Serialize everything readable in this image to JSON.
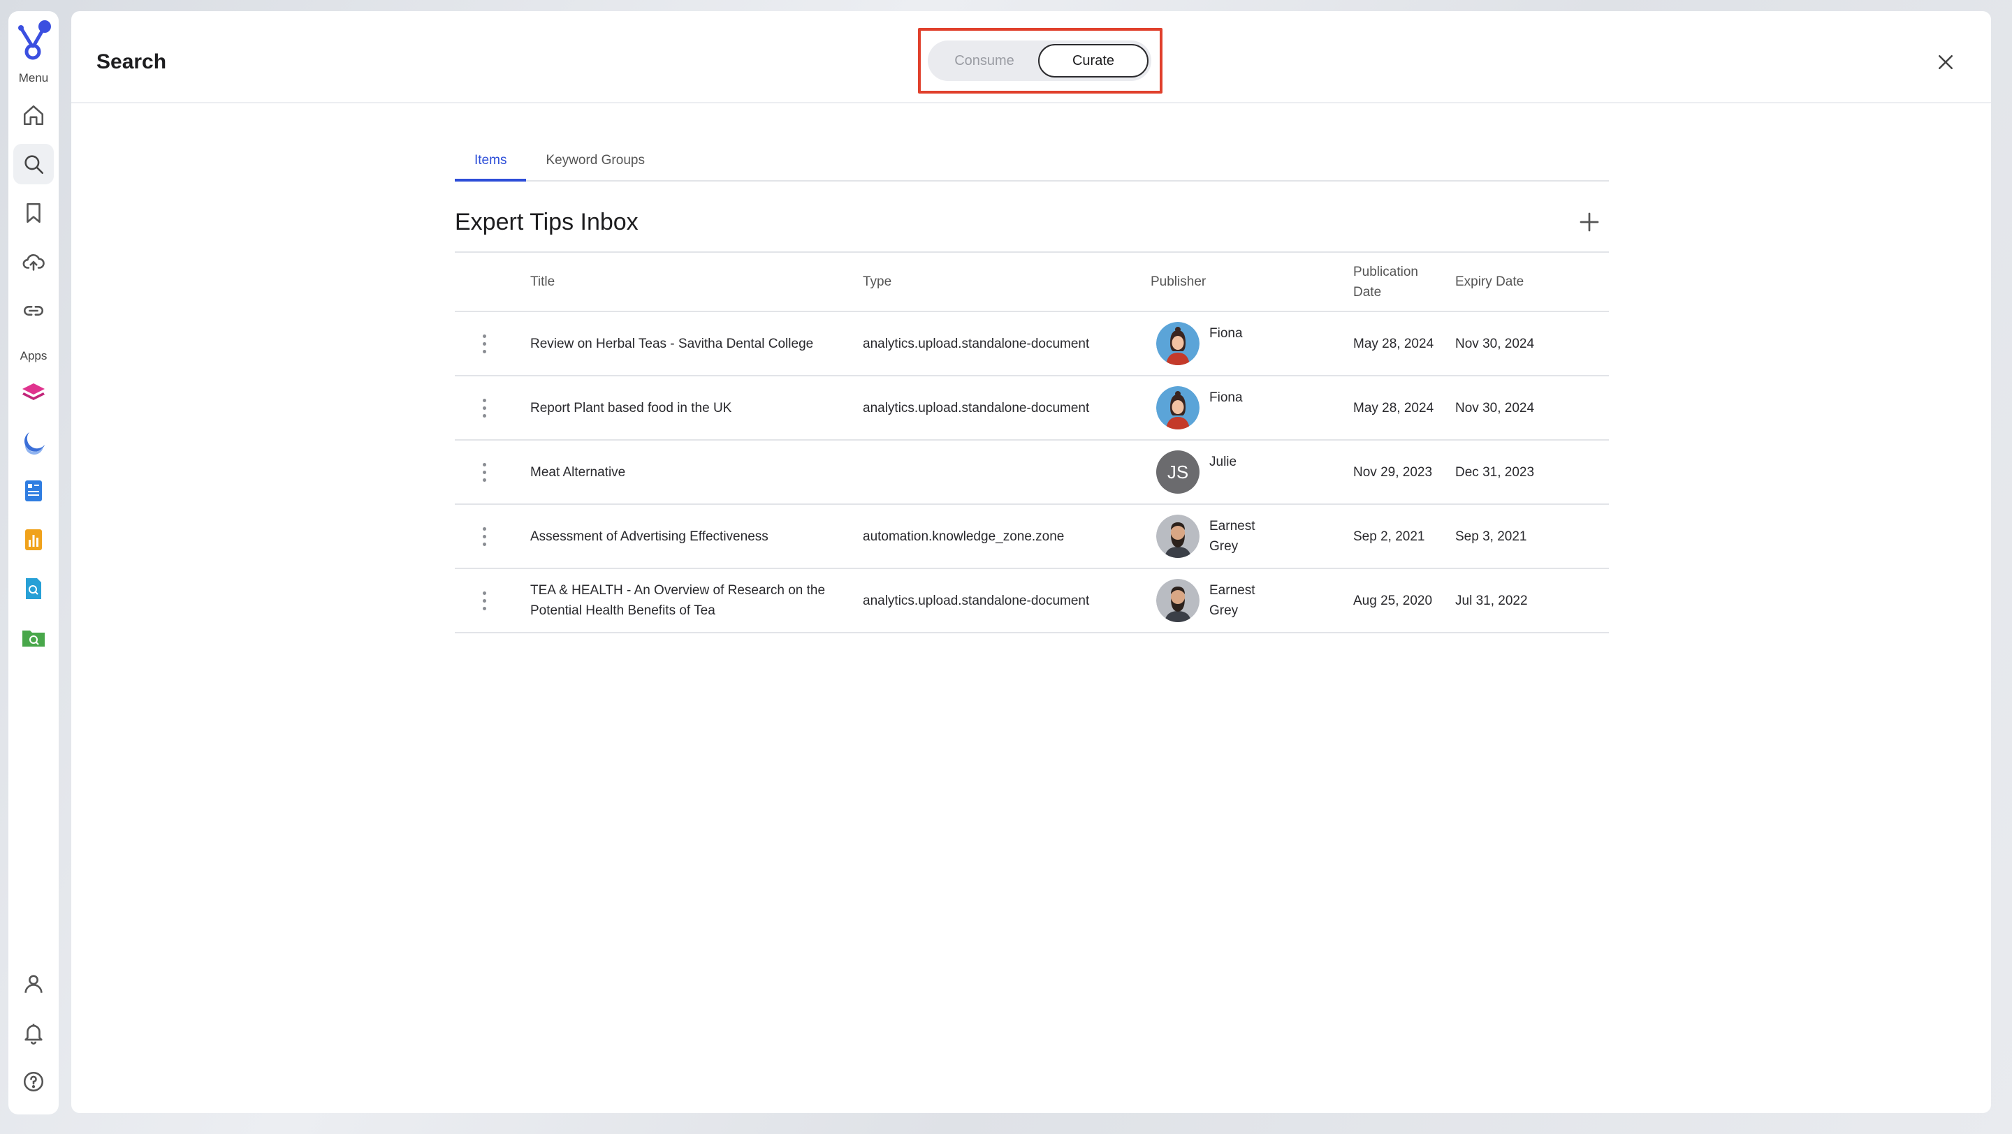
{
  "rail": {
    "menu_label": "Menu",
    "apps_label": "Apps",
    "nav_items": [
      {
        "icon": "home-icon"
      },
      {
        "icon": "search-icon",
        "active": true
      },
      {
        "icon": "bookmark-icon"
      },
      {
        "icon": "upload-cloud-icon"
      },
      {
        "icon": "link-icon"
      }
    ],
    "apps": [
      {
        "icon": "pink-layers-app-icon",
        "color": "#e0338e"
      },
      {
        "icon": "blue-moon-app-icon",
        "color": "#3b6fd8"
      },
      {
        "icon": "blue-document-app-icon",
        "color": "#2f7de1"
      },
      {
        "icon": "orange-chart-app-icon",
        "color": "#f0a21b"
      },
      {
        "icon": "blue-search-doc-app-icon",
        "color": "#27a0d6"
      },
      {
        "icon": "green-folder-search-app-icon",
        "color": "#48a74a"
      }
    ],
    "bottom_items": [
      {
        "icon": "user-icon"
      },
      {
        "icon": "bell-icon"
      },
      {
        "icon": "help-icon"
      }
    ]
  },
  "header": {
    "title": "Search",
    "mode_options": [
      "Consume",
      "Curate"
    ],
    "selected_mode": "Curate"
  },
  "tabs": [
    {
      "label": "Items",
      "active": true
    },
    {
      "label": "Keyword Groups",
      "active": false
    }
  ],
  "section": {
    "title": "Expert Tips Inbox"
  },
  "table": {
    "columns": {
      "title": "Title",
      "type": "Type",
      "publisher": "Publisher",
      "publication_date": "Publication Date",
      "expiry_date": "Expiry Date"
    },
    "rows": [
      {
        "title": "Review on Herbal Teas - Savitha Dental College",
        "type": "analytics.upload.standalone-document",
        "publisher": "Fiona",
        "avatar": "fiona",
        "publication_date": "May 28, 2024",
        "expiry_date": "Nov 30, 2024"
      },
      {
        "title": "Report Plant based food in the UK",
        "type": "analytics.upload.standalone-document",
        "publisher": "Fiona",
        "avatar": "fiona",
        "publication_date": "May 28, 2024",
        "expiry_date": "Nov 30, 2024"
      },
      {
        "title": "Meat Alternative",
        "type": "",
        "publisher": "Julie",
        "avatar": "initials",
        "initials": "JS",
        "publication_date": "Nov 29, 2023",
        "expiry_date": "Dec 31, 2023"
      },
      {
        "title": "Assessment of Advertising Effectiveness",
        "type": "automation.knowledge_zone.zone",
        "publisher": "Earnest Grey",
        "avatar": "earnest",
        "publication_date": "Sep 2, 2021",
        "expiry_date": "Sep 3, 2021"
      },
      {
        "title": "TEA & HEALTH - An Overview of Research on the Potential Health Benefits of Tea",
        "type": "analytics.upload.standalone-document",
        "publisher": "Earnest Grey",
        "avatar": "earnest",
        "publication_date": "Aug 25, 2020",
        "expiry_date": "Jul 31, 2022"
      }
    ]
  },
  "colors": {
    "accent": "#2d4ed8",
    "highlight_box": "#e0402c",
    "logo": "#3b4fe0"
  }
}
